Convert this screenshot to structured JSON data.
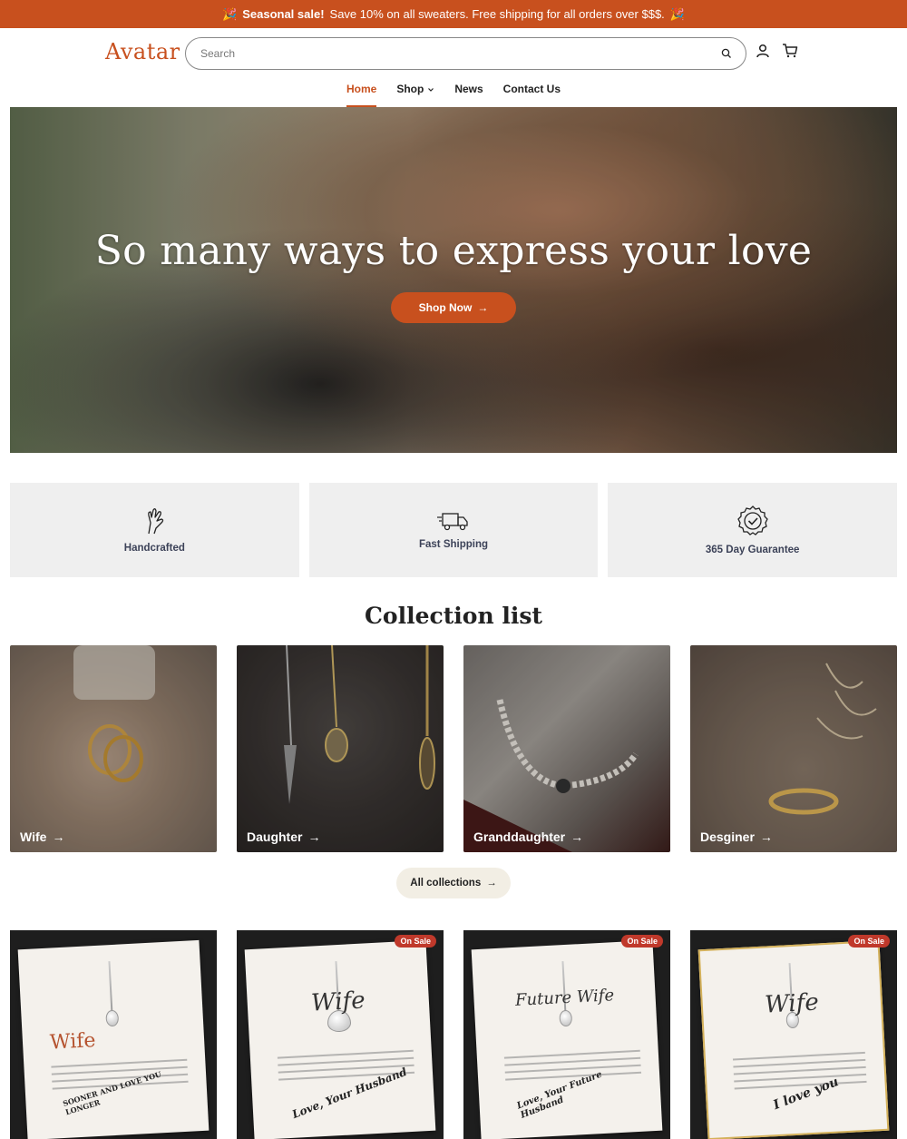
{
  "announcement": {
    "strong": "Seasonal sale!",
    "text": "Save 10% on all sweaters. Free shipping for all orders over $$$.",
    "emoji": "🎉"
  },
  "header": {
    "logo": "Avatar",
    "search_placeholder": "Search",
    "icons": [
      "search-icon",
      "account-icon",
      "cart-icon"
    ]
  },
  "nav": {
    "items": [
      {
        "label": "Home",
        "active": true
      },
      {
        "label": "Shop",
        "dropdown": true
      },
      {
        "label": "News"
      },
      {
        "label": "Contact Us"
      }
    ]
  },
  "hero": {
    "title": "So many ways to express your love",
    "cta": "Shop Now"
  },
  "features": [
    {
      "label": "Handcrafted",
      "icon": "hand-icon"
    },
    {
      "label": "Fast Shipping",
      "icon": "truck-icon"
    },
    {
      "label": "365 Day Guarantee",
      "icon": "badge-check-icon"
    }
  ],
  "collections": {
    "title": "Collection list",
    "items": [
      "Wife",
      "Daughter",
      "Granddaughter",
      "Desginer"
    ],
    "all_label": "All collections"
  },
  "products": {
    "badge": "On Sale",
    "items": [
      {
        "on_sale": false,
        "card_title": "Wife",
        "signature": "SOONER AND LOVE YOU LONGER"
      },
      {
        "on_sale": true,
        "card_title": "Wife",
        "signature": "Love, Your Husband"
      },
      {
        "on_sale": true,
        "card_title": "Future Wife",
        "signature": "Love, Your Future Husband"
      },
      {
        "on_sale": true,
        "card_title": "Wife",
        "signature": "I love you"
      }
    ]
  },
  "colors": {
    "accent": "#c8501e",
    "feature_bg": "#efefef",
    "sale_badge": "#c0392b"
  }
}
